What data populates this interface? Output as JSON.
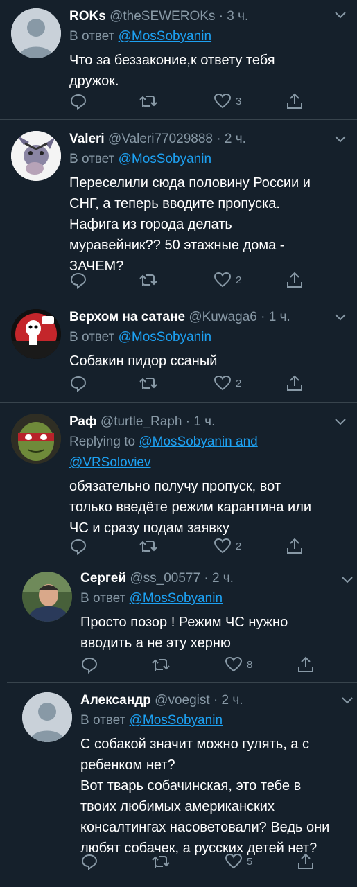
{
  "tweets": [
    {
      "name": "ROKs",
      "handle": "@theSEWEROKs",
      "time": "3 ч.",
      "reply_prefix": "В ответ ",
      "mention": "@MosSobyanin",
      "mention2": "",
      "text": "Что за беззаконие,к ответу тебя\nдружок.",
      "likes": "3",
      "avatar": "default-avatar"
    },
    {
      "name": "Valeri",
      "handle": "@Valeri77029888",
      "time": "2 ч.",
      "reply_prefix": "В ответ ",
      "mention": "@MosSobyanin",
      "mention2": "",
      "text": "Переселили сюда половину России и\nСНГ, а теперь вводите пропуска.\nНафига из города делать\nмуравейник?? 50 этажные дома -\nЗАЧЕМ?",
      "likes": "2",
      "avatar": "donkey-avatar"
    },
    {
      "name": "Верхом на сатане",
      "handle": "@Kuwaga6",
      "time": "1 ч.",
      "reply_prefix": "В ответ ",
      "mention": "@MosSobyanin",
      "mention2": "",
      "text": "Собакин пидор ссаный",
      "likes": "2",
      "avatar": "cartoon-dog-avatar"
    },
    {
      "name": "Раф",
      "handle": "@turtle_Raph",
      "time": "1 ч.",
      "reply_prefix": "Replying to ",
      "mention": "@MosSobyanin and",
      "mention2": "@VRSoloviev",
      "text": "обязательно получу пропуск, вот\nтолько введёте режим карантина или\nЧС и сразу подам заявку",
      "likes": "2",
      "avatar": "turtle-avatar"
    },
    {
      "name": "Сергей",
      "handle": "@ss_00577",
      "time": "2 ч.",
      "reply_prefix": "В ответ ",
      "mention": "@MosSobyanin",
      "mention2": "",
      "text": "Просто позор ! Режим ЧС нужно\nвводить а не эту херню",
      "likes": "8",
      "avatar": "photo-avatar"
    },
    {
      "name": "Александр",
      "handle": "@voegist",
      "time": "2 ч.",
      "reply_prefix": "В ответ ",
      "mention": "@MosSobyanin",
      "mention2": "",
      "text": "С собакой значит можно гулять, а с\nребенком нет?\nВот тварь собачинская, это тебе в\nтвоих любимых американских\nконсалтингах насоветовали? Ведь они\nлюбят собачек, а русских детей нет?",
      "likes": "5",
      "avatar": "default-avatar"
    }
  ],
  "separator_dot": "·",
  "colors": {
    "background": "#15202b",
    "secondary_text": "#8899a6",
    "link": "#1da1f2",
    "divider": "#38444d"
  }
}
